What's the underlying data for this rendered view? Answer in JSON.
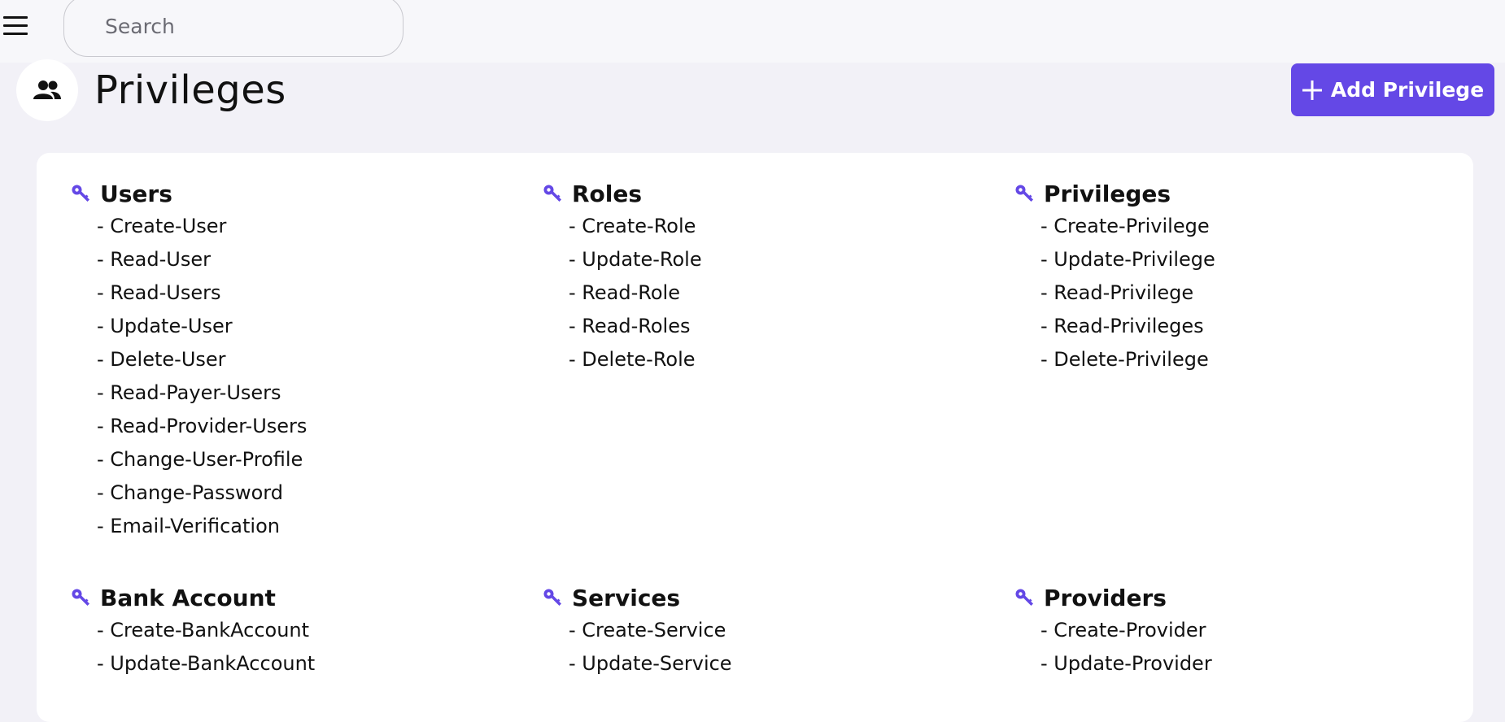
{
  "search": {
    "placeholder": "Search"
  },
  "header": {
    "title": "Privileges",
    "add_button_label": "Add Privilege"
  },
  "groups": [
    {
      "title": "Users",
      "items": [
        "Create-User",
        "Read-User",
        "Read-Users",
        "Update-User",
        "Delete-User",
        "Read-Payer-Users",
        "Read-Provider-Users",
        "Change-User-Profile",
        "Change-Password",
        "Email-Verification"
      ]
    },
    {
      "title": "Roles",
      "items": [
        "Create-Role",
        "Update-Role",
        "Read-Role",
        "Read-Roles",
        "Delete-Role"
      ]
    },
    {
      "title": "Privileges",
      "items": [
        "Create-Privilege",
        "Update-Privilege",
        "Read-Privilege",
        "Read-Privileges",
        "Delete-Privilege"
      ]
    },
    {
      "title": "Bank Account",
      "items": [
        "Create-BankAccount",
        "Update-BankAccount"
      ]
    },
    {
      "title": "Services",
      "items": [
        "Create-Service",
        "Update-Service"
      ]
    },
    {
      "title": "Providers",
      "items": [
        "Create-Provider",
        "Update-Provider"
      ]
    }
  ],
  "colors": {
    "accent": "#6448e6",
    "page_background": "#f2f1f7",
    "card_background": "#ffffff"
  },
  "icons": {
    "menu": "hamburger-menu-icon",
    "avatar": "people-icon",
    "add": "plus-icon",
    "group": "key-icon"
  }
}
